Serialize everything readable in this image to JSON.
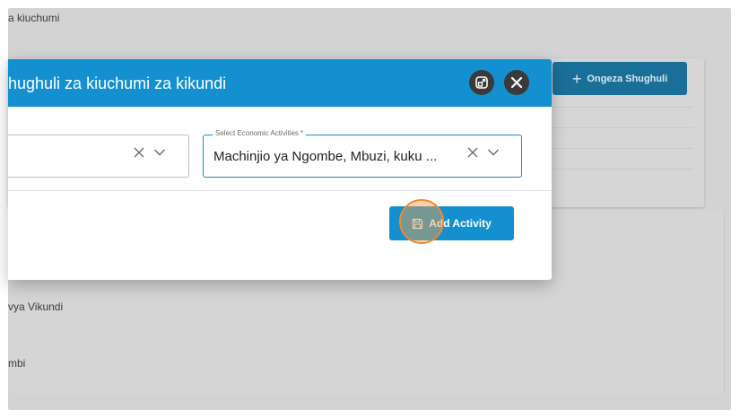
{
  "background": {
    "section_title": "a kiuchumi",
    "add_button_label": "Ongeza Shughuli",
    "label_1": "vya Vikundi",
    "label_2": "mbi"
  },
  "modal": {
    "title": "hughuli za kiuchumi za kikundi",
    "left_field": {
      "value": ""
    },
    "right_field": {
      "legend": "Select Economic Activities *",
      "value": "Machinjio ya Ngombe, Mbuzi, kuku ..."
    },
    "action_button_label": "Add Activity"
  },
  "colors": {
    "header": "#1490d0",
    "button": "#1490d0",
    "dim_button": "#1a6f99",
    "click_indicator": "#f08a2c"
  },
  "icons": {
    "expand": "expand-icon",
    "close": "close-icon",
    "clear": "clear-icon",
    "dropdown": "chevron-down-icon",
    "save": "save-icon",
    "plus": "plus-icon"
  }
}
